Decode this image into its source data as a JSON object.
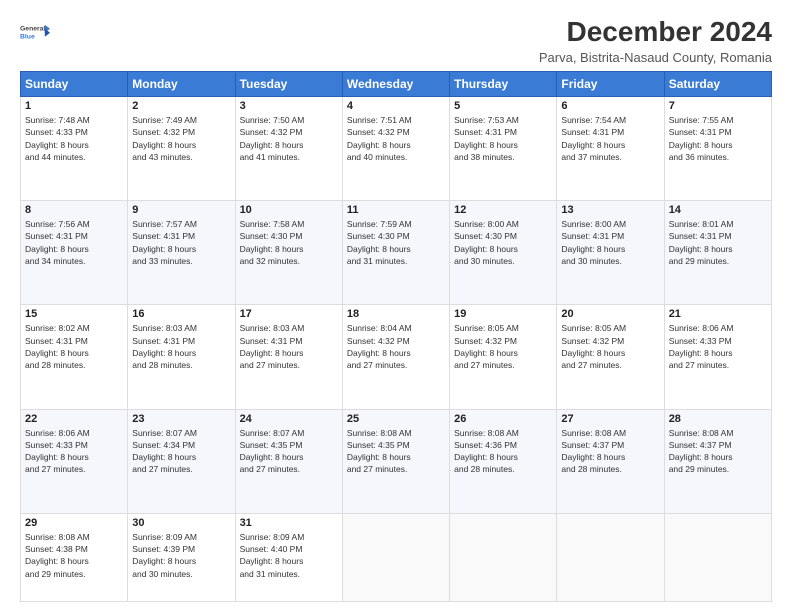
{
  "logo": {
    "line1": "General",
    "line2": "Blue"
  },
  "title": "December 2024",
  "subtitle": "Parva, Bistrita-Nasaud County, Romania",
  "days_header": [
    "Sunday",
    "Monday",
    "Tuesday",
    "Wednesday",
    "Thursday",
    "Friday",
    "Saturday"
  ],
  "weeks": [
    [
      {
        "day": "1",
        "sunrise": "7:48 AM",
        "sunset": "4:33 PM",
        "daylight": "8 hours and 44 minutes."
      },
      {
        "day": "2",
        "sunrise": "7:49 AM",
        "sunset": "4:32 PM",
        "daylight": "8 hours and 43 minutes."
      },
      {
        "day": "3",
        "sunrise": "7:50 AM",
        "sunset": "4:32 PM",
        "daylight": "8 hours and 41 minutes."
      },
      {
        "day": "4",
        "sunrise": "7:51 AM",
        "sunset": "4:32 PM",
        "daylight": "8 hours and 40 minutes."
      },
      {
        "day": "5",
        "sunrise": "7:53 AM",
        "sunset": "4:31 PM",
        "daylight": "8 hours and 38 minutes."
      },
      {
        "day": "6",
        "sunrise": "7:54 AM",
        "sunset": "4:31 PM",
        "daylight": "8 hours and 37 minutes."
      },
      {
        "day": "7",
        "sunrise": "7:55 AM",
        "sunset": "4:31 PM",
        "daylight": "8 hours and 36 minutes."
      }
    ],
    [
      {
        "day": "8",
        "sunrise": "7:56 AM",
        "sunset": "4:31 PM",
        "daylight": "8 hours and 34 minutes."
      },
      {
        "day": "9",
        "sunrise": "7:57 AM",
        "sunset": "4:31 PM",
        "daylight": "8 hours and 33 minutes."
      },
      {
        "day": "10",
        "sunrise": "7:58 AM",
        "sunset": "4:30 PM",
        "daylight": "8 hours and 32 minutes."
      },
      {
        "day": "11",
        "sunrise": "7:59 AM",
        "sunset": "4:30 PM",
        "daylight": "8 hours and 31 minutes."
      },
      {
        "day": "12",
        "sunrise": "8:00 AM",
        "sunset": "4:30 PM",
        "daylight": "8 hours and 30 minutes."
      },
      {
        "day": "13",
        "sunrise": "8:00 AM",
        "sunset": "4:31 PM",
        "daylight": "8 hours and 30 minutes."
      },
      {
        "day": "14",
        "sunrise": "8:01 AM",
        "sunset": "4:31 PM",
        "daylight": "8 hours and 29 minutes."
      }
    ],
    [
      {
        "day": "15",
        "sunrise": "8:02 AM",
        "sunset": "4:31 PM",
        "daylight": "8 hours and 28 minutes."
      },
      {
        "day": "16",
        "sunrise": "8:03 AM",
        "sunset": "4:31 PM",
        "daylight": "8 hours and 28 minutes."
      },
      {
        "day": "17",
        "sunrise": "8:03 AM",
        "sunset": "4:31 PM",
        "daylight": "8 hours and 27 minutes."
      },
      {
        "day": "18",
        "sunrise": "8:04 AM",
        "sunset": "4:32 PM",
        "daylight": "8 hours and 27 minutes."
      },
      {
        "day": "19",
        "sunrise": "8:05 AM",
        "sunset": "4:32 PM",
        "daylight": "8 hours and 27 minutes."
      },
      {
        "day": "20",
        "sunrise": "8:05 AM",
        "sunset": "4:32 PM",
        "daylight": "8 hours and 27 minutes."
      },
      {
        "day": "21",
        "sunrise": "8:06 AM",
        "sunset": "4:33 PM",
        "daylight": "8 hours and 27 minutes."
      }
    ],
    [
      {
        "day": "22",
        "sunrise": "8:06 AM",
        "sunset": "4:33 PM",
        "daylight": "8 hours and 27 minutes."
      },
      {
        "day": "23",
        "sunrise": "8:07 AM",
        "sunset": "4:34 PM",
        "daylight": "8 hours and 27 minutes."
      },
      {
        "day": "24",
        "sunrise": "8:07 AM",
        "sunset": "4:35 PM",
        "daylight": "8 hours and 27 minutes."
      },
      {
        "day": "25",
        "sunrise": "8:08 AM",
        "sunset": "4:35 PM",
        "daylight": "8 hours and 27 minutes."
      },
      {
        "day": "26",
        "sunrise": "8:08 AM",
        "sunset": "4:36 PM",
        "daylight": "8 hours and 28 minutes."
      },
      {
        "day": "27",
        "sunrise": "8:08 AM",
        "sunset": "4:37 PM",
        "daylight": "8 hours and 28 minutes."
      },
      {
        "day": "28",
        "sunrise": "8:08 AM",
        "sunset": "4:37 PM",
        "daylight": "8 hours and 29 minutes."
      }
    ],
    [
      {
        "day": "29",
        "sunrise": "8:08 AM",
        "sunset": "4:38 PM",
        "daylight": "8 hours and 29 minutes."
      },
      {
        "day": "30",
        "sunrise": "8:09 AM",
        "sunset": "4:39 PM",
        "daylight": "8 hours and 30 minutes."
      },
      {
        "day": "31",
        "sunrise": "8:09 AM",
        "sunset": "4:40 PM",
        "daylight": "8 hours and 31 minutes."
      },
      null,
      null,
      null,
      null
    ]
  ]
}
